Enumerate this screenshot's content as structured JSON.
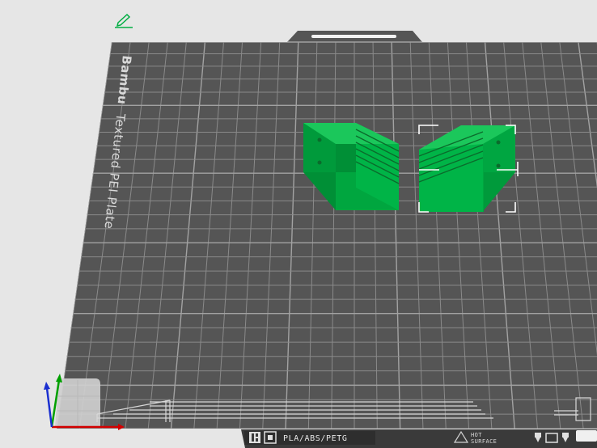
{
  "plate": {
    "brand": "Bambu",
    "name": "Textured PEI Plate"
  },
  "bottom_bar": {
    "filament_types": "PLA/ABS/PETG",
    "hot_label": "HOT",
    "surface_label": "SURFACE"
  },
  "icons": {
    "edit": "pencil-icon",
    "bar_left": [
      "bambu-logo-icon",
      "plate-corner-icon"
    ],
    "bar_right": [
      "hot-surface-warning-icon",
      "nozzle-icon",
      "plate-frame-icon"
    ]
  },
  "colors": {
    "background": "#e6e6e6",
    "plate": "#555555",
    "grid": "#8e8e8e",
    "object_green": "#00ae42",
    "axis_x": "#d40000",
    "axis_y": "#00a000",
    "axis_z": "#1a2fd0",
    "selection": "#ffffff"
  }
}
